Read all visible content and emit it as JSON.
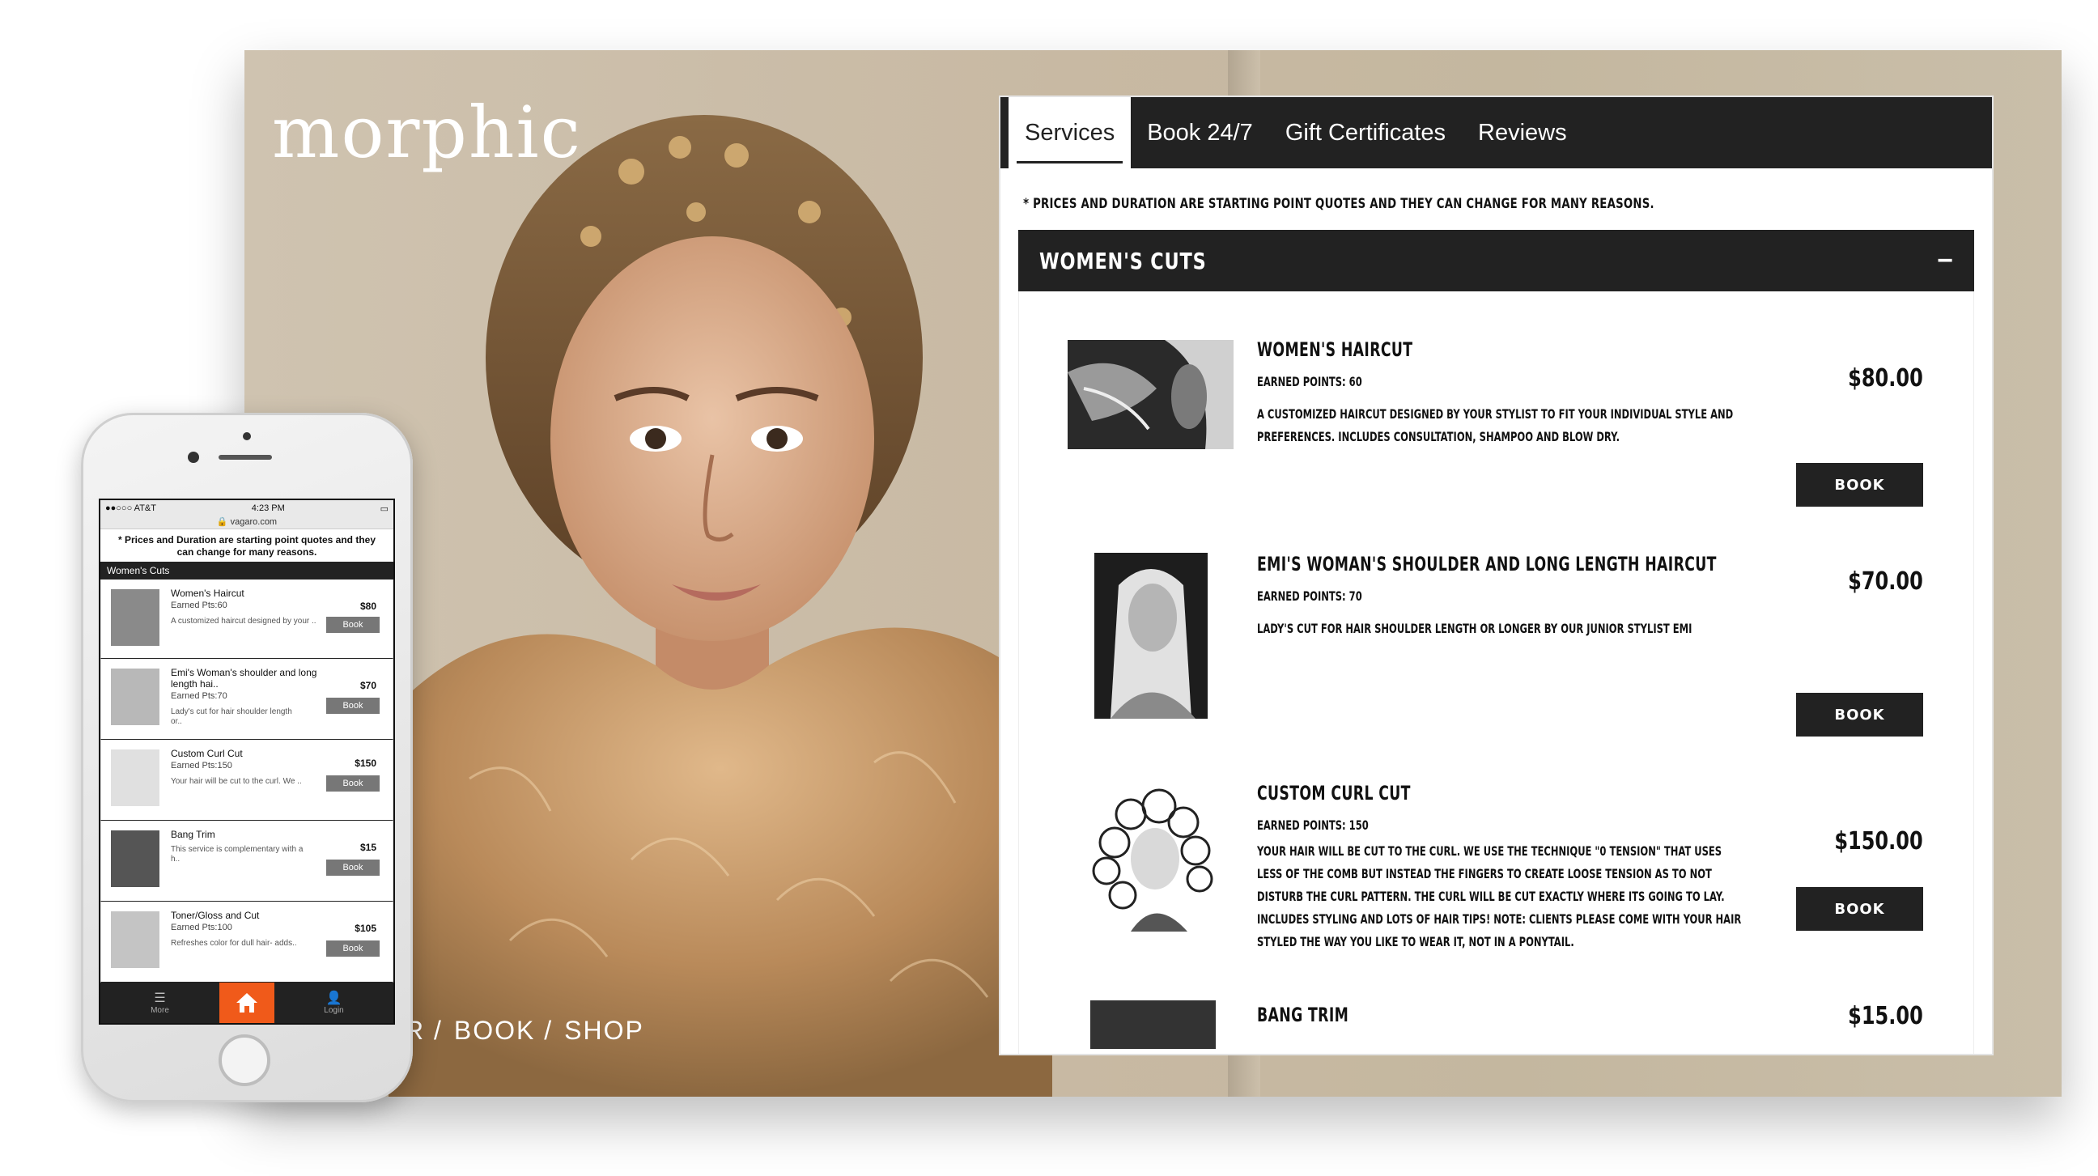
{
  "hero": {
    "logo": "morphic",
    "nav": [
      "R /",
      "BOOK /",
      "SHOP"
    ]
  },
  "tabs": [
    {
      "label": "Services",
      "active": true
    },
    {
      "label": "Book 24/7",
      "active": false
    },
    {
      "label": "Gift Certificates",
      "active": false
    },
    {
      "label": "Reviews",
      "active": false
    }
  ],
  "notice": "* Prices and Duration are starting point quotes and they can change for many reasons.",
  "section": {
    "title": "WOMEN'S CUTS",
    "toggle": "−"
  },
  "services": [
    {
      "name": "WOMEN'S HAIRCUT",
      "points": "EARNED POINTS: 60",
      "desc": "A customized haircut designed by your stylist to fit your individual style and preferences. Includes consultation, shampoo and blow dry.",
      "price": "$80.00",
      "book": "BOOK"
    },
    {
      "name": "EMI'S WOMAN'S SHOULDER AND LONG LENGTH HAIRCUT",
      "points": "EARNED POINTS: 70",
      "desc": "Lady's cut for hair shoulder length or longer by our junior stylist Emi",
      "price": "$70.00",
      "book": "BOOK"
    },
    {
      "name": "CUSTOM CURL CUT",
      "points": "EARNED POINTS: 150",
      "desc": "Your hair will be cut to the curl. We use the technique \"0 tension\" that uses less of the comb but instead the fingers to create loose tension as to not disturb the curl pattern. The curl will be cut exactly where its going to lay. Includes styling and lots of hair tips! Note: Clients please come with your hair styled the way you like to wear it, not in a ponytail.",
      "price": "$150.00",
      "book": "BOOK"
    },
    {
      "name": "BANG TRIM",
      "points": "",
      "desc": "",
      "price": "$15.00",
      "book": ""
    }
  ],
  "mobile": {
    "carrier": "●●○○○ AT&T",
    "time": "4:23 PM",
    "battery": "▭",
    "url": "🔒 vagaro.com",
    "notice": "* Prices and Duration are starting point quotes and they can change for many reasons.",
    "section": "Women's Cuts",
    "items": [
      {
        "name": "Women's Haircut",
        "pts": "Earned Pts:60",
        "desc": "A customized haircut designed by your ..",
        "price": "$80",
        "book": "Book"
      },
      {
        "name": "Emi's Woman's shoulder and long length hai..",
        "pts": "Earned Pts:70",
        "desc": "Lady's cut for hair shoulder length or..",
        "price": "$70",
        "book": "Book"
      },
      {
        "name": "Custom Curl Cut",
        "pts": "Earned Pts:150",
        "desc": "Your hair will be cut to the curl. We ..",
        "price": "$150",
        "book": "Book"
      },
      {
        "name": "Bang Trim",
        "pts": "",
        "desc": "This service is complementary with a h..",
        "price": "$15",
        "book": "Book"
      },
      {
        "name": "Toner/Gloss and Cut",
        "pts": "Earned Pts:100",
        "desc": "Refreshes color for dull hair- adds..",
        "price": "$105",
        "book": "Book"
      }
    ],
    "tabbar": {
      "more": "More",
      "login": "Login"
    }
  },
  "colors": {
    "dark": "#222222",
    "accent": "#f05a1a",
    "hero_bg": "#c8b9a3"
  }
}
